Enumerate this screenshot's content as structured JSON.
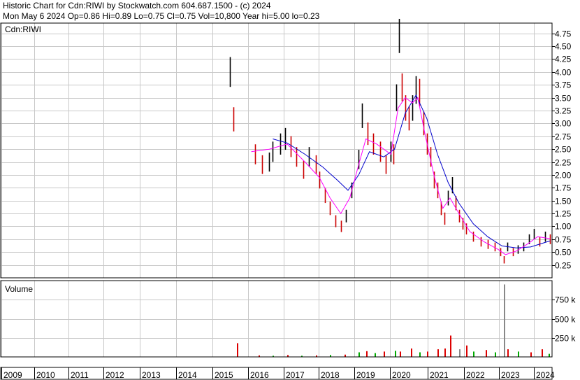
{
  "header": {
    "line1": "Historic Chart for Cdn:RIWI by Stockwatch.com 604.687.1500 - (c) 2024",
    "line2": "Mon May  6 2024  Op=0.86  Hi=0.89  Lo=0.75  Cl=0.75  Vol=10,800  Year hi=5.00  lo=0.23"
  },
  "chart_data": [
    {
      "type": "line",
      "title": "Cdn:RIWI",
      "x_ticks": [
        "2009",
        "2010",
        "2011",
        "2012",
        "2013",
        "2014",
        "2015",
        "2016",
        "2017",
        "2018",
        "2019",
        "2020",
        "2021",
        "2022",
        "2023",
        "2024"
      ],
      "xlim": [
        2009.0,
        2024.4
      ],
      "ylim": [
        0.0,
        4.95
      ],
      "y_ticks": [
        "0.25",
        "0.50",
        "0.75",
        "1.00",
        "1.25",
        "1.50",
        "1.75",
        "2.00",
        "2.25",
        "2.50",
        "2.75",
        "3.00",
        "3.25",
        "3.50",
        "3.75",
        "4.00",
        "4.25",
        "4.50",
        "4.75"
      ],
      "grid": true,
      "colors": {
        "price": "#000000",
        "down": "#cc0000",
        "ma_short": "#ff00ff",
        "ma_long": "#0000cc"
      },
      "price_points": [
        [
          2015.4,
          4.0
        ],
        [
          2015.5,
          3.08
        ],
        [
          2016.1,
          2.4
        ],
        [
          2016.3,
          2.2
        ],
        [
          2016.5,
          2.25
        ],
        [
          2016.6,
          2.45
        ],
        [
          2016.8,
          2.6
        ],
        [
          2016.95,
          2.7
        ],
        [
          2017.1,
          2.55
        ],
        [
          2017.25,
          2.35
        ],
        [
          2017.45,
          2.1
        ],
        [
          2017.6,
          2.35
        ],
        [
          2017.8,
          2.2
        ],
        [
          2017.9,
          1.9
        ],
        [
          2018.05,
          1.6
        ],
        [
          2018.2,
          1.35
        ],
        [
          2018.35,
          1.1
        ],
        [
          2018.5,
          1.0
        ],
        [
          2018.65,
          1.2
        ],
        [
          2018.8,
          1.7
        ],
        [
          2019.0,
          2.3
        ],
        [
          2019.1,
          3.15
        ],
        [
          2019.25,
          2.8
        ],
        [
          2019.4,
          2.6
        ],
        [
          2019.6,
          2.45
        ],
        [
          2019.75,
          2.2
        ],
        [
          2019.9,
          2.45
        ],
        [
          2019.97,
          2.4
        ],
        [
          2020.05,
          3.5
        ],
        [
          2020.12,
          4.7
        ],
        [
          2020.2,
          3.7
        ],
        [
          2020.3,
          3.3
        ],
        [
          2020.4,
          3.1
        ],
        [
          2020.5,
          3.3
        ],
        [
          2020.6,
          3.65
        ],
        [
          2020.7,
          3.6
        ],
        [
          2020.8,
          3.0
        ],
        [
          2020.9,
          2.6
        ],
        [
          2021.0,
          2.35
        ],
        [
          2021.1,
          1.9
        ],
        [
          2021.2,
          1.7
        ],
        [
          2021.3,
          1.35
        ],
        [
          2021.4,
          1.15
        ],
        [
          2021.5,
          1.55
        ],
        [
          2021.6,
          1.8
        ],
        [
          2021.7,
          1.45
        ],
        [
          2021.8,
          1.2
        ],
        [
          2021.9,
          1.05
        ],
        [
          2022.0,
          0.95
        ],
        [
          2022.2,
          0.8
        ],
        [
          2022.4,
          0.7
        ],
        [
          2022.6,
          0.65
        ],
        [
          2022.8,
          0.6
        ],
        [
          2022.95,
          0.5
        ],
        [
          2023.05,
          0.35
        ],
        [
          2023.15,
          0.6
        ],
        [
          2023.3,
          0.5
        ],
        [
          2023.45,
          0.55
        ],
        [
          2023.6,
          0.6
        ],
        [
          2023.75,
          0.75
        ],
        [
          2023.9,
          0.85
        ],
        [
          2024.05,
          0.7
        ],
        [
          2024.2,
          0.8
        ],
        [
          2024.35,
          0.75
        ]
      ],
      "ma_short_points": [
        [
          2016.0,
          2.45
        ],
        [
          2016.5,
          2.5
        ],
        [
          2017.0,
          2.6
        ],
        [
          2017.5,
          2.25
        ],
        [
          2017.9,
          1.95
        ],
        [
          2018.2,
          1.55
        ],
        [
          2018.5,
          1.25
        ],
        [
          2018.75,
          1.55
        ],
        [
          2019.0,
          2.2
        ],
        [
          2019.2,
          2.7
        ],
        [
          2019.5,
          2.6
        ],
        [
          2019.9,
          2.4
        ],
        [
          2020.1,
          3.3
        ],
        [
          2020.3,
          3.5
        ],
        [
          2020.5,
          3.4
        ],
        [
          2020.65,
          3.5
        ],
        [
          2020.85,
          2.8
        ],
        [
          2021.1,
          2.0
        ],
        [
          2021.35,
          1.35
        ],
        [
          2021.55,
          1.55
        ],
        [
          2021.8,
          1.25
        ],
        [
          2022.1,
          0.9
        ],
        [
          2022.5,
          0.7
        ],
        [
          2022.9,
          0.55
        ],
        [
          2023.1,
          0.45
        ],
        [
          2023.4,
          0.52
        ],
        [
          2023.7,
          0.65
        ],
        [
          2024.0,
          0.8
        ],
        [
          2024.35,
          0.76
        ]
      ],
      "ma_long_points": [
        [
          2016.6,
          2.7
        ],
        [
          2017.0,
          2.62
        ],
        [
          2017.5,
          2.4
        ],
        [
          2018.0,
          2.15
        ],
        [
          2018.4,
          1.9
        ],
        [
          2018.7,
          1.7
        ],
        [
          2019.0,
          2.0
        ],
        [
          2019.3,
          2.45
        ],
        [
          2019.7,
          2.35
        ],
        [
          2020.0,
          2.5
        ],
        [
          2020.3,
          3.2
        ],
        [
          2020.6,
          3.55
        ],
        [
          2020.9,
          3.1
        ],
        [
          2021.2,
          2.4
        ],
        [
          2021.5,
          1.85
        ],
        [
          2021.8,
          1.45
        ],
        [
          2022.2,
          1.05
        ],
        [
          2022.6,
          0.8
        ],
        [
          2023.0,
          0.62
        ],
        [
          2023.4,
          0.58
        ],
        [
          2023.8,
          0.6
        ],
        [
          2024.35,
          0.72
        ]
      ]
    },
    {
      "type": "bar",
      "title": "Volume",
      "y_ticks": [
        "250 k",
        "500 k",
        "750 k"
      ],
      "ylim": [
        0,
        1000
      ],
      "unit": "k",
      "colors": {
        "up": "#00aa00",
        "down": "#dd0000",
        "flat": "#888888"
      },
      "bars": [
        [
          2015.6,
          180,
          "down"
        ],
        [
          2016.2,
          20,
          "down"
        ],
        [
          2016.6,
          15,
          "up"
        ],
        [
          2017.0,
          25,
          "down"
        ],
        [
          2017.4,
          15,
          "up"
        ],
        [
          2017.8,
          20,
          "down"
        ],
        [
          2018.2,
          25,
          "up"
        ],
        [
          2018.6,
          30,
          "down"
        ],
        [
          2019.0,
          60,
          "up"
        ],
        [
          2019.2,
          75,
          "down"
        ],
        [
          2019.45,
          50,
          "up"
        ],
        [
          2019.7,
          70,
          "down"
        ],
        [
          2020.0,
          80,
          "up"
        ],
        [
          2020.15,
          70,
          "down"
        ],
        [
          2020.45,
          110,
          "down"
        ],
        [
          2020.7,
          60,
          "up"
        ],
        [
          2020.9,
          70,
          "down"
        ],
        [
          2021.2,
          100,
          "down"
        ],
        [
          2021.4,
          110,
          "down"
        ],
        [
          2021.55,
          280,
          "down"
        ],
        [
          2021.8,
          100,
          "flat"
        ],
        [
          2022.0,
          150,
          "down"
        ],
        [
          2022.2,
          70,
          "up"
        ],
        [
          2022.55,
          90,
          "down"
        ],
        [
          2022.8,
          60,
          "up"
        ],
        [
          2023.05,
          950,
          "flat"
        ],
        [
          2023.15,
          100,
          "down"
        ],
        [
          2023.45,
          70,
          "up"
        ],
        [
          2023.8,
          60,
          "down"
        ],
        [
          2024.1,
          100,
          "down"
        ],
        [
          2024.3,
          40,
          "up"
        ]
      ]
    }
  ]
}
